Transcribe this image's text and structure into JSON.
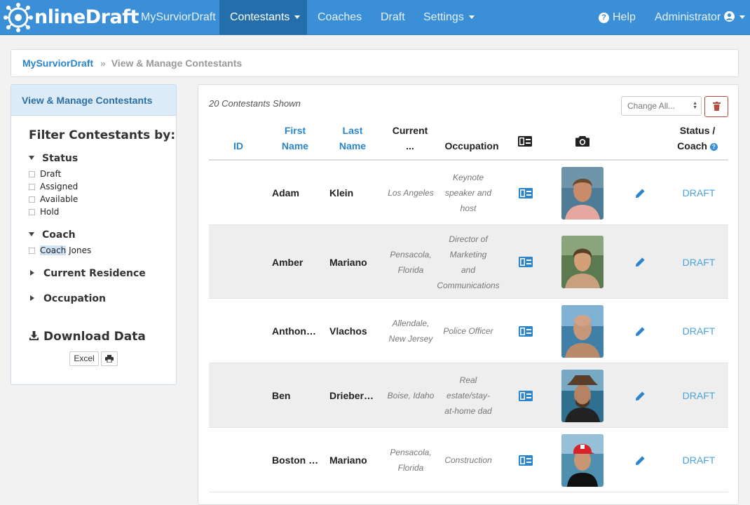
{
  "colors": {
    "navbar": "#3a8fd6",
    "nav_active": "#236eab",
    "link": "#2a85cc",
    "draft": "#4aa3df"
  },
  "brand": {
    "name": "nlineDraft",
    "logo": "network-logo-icon"
  },
  "nav": {
    "items": [
      {
        "label": "MySurviorDraft"
      },
      {
        "label": "Contestants"
      },
      {
        "label": "Coaches"
      },
      {
        "label": "Draft"
      },
      {
        "label": "Settings"
      }
    ],
    "help": "Help",
    "user": "Administrator"
  },
  "breadcrumb": {
    "root": "MySurviorDraft",
    "sep": "»",
    "current": "View & Manage Contestants"
  },
  "sidebar": {
    "header": "View & Manage Contestants",
    "filter_title": "Filter Contestants by:",
    "status": {
      "title": "Status",
      "options": [
        "Draft",
        "Assigned",
        "Available",
        "Hold"
      ]
    },
    "coach": {
      "title": "Coach",
      "option_highlight": "Coach",
      "option_rest": " Jones"
    },
    "residence": {
      "title": "Current Residence"
    },
    "occupation": {
      "title": "Occupation"
    },
    "download": {
      "title": "Download Data",
      "excel": "Excel",
      "print_icon": "printer-icon"
    }
  },
  "main": {
    "count": "20 Contestants Shown",
    "change_all": "Change All...",
    "headers": {
      "id": "ID",
      "first1": "First",
      "first2": "Name",
      "last1": "Last",
      "last2": "Name",
      "current1": "Current",
      "current2": "...",
      "occupation": "Occupation",
      "status1": "Status /",
      "status2": "Coach"
    },
    "rows": [
      {
        "first": "Adam",
        "last": "Klein",
        "residence": [
          "Los Angeles"
        ],
        "occupation": [
          "Keynote",
          "speaker and",
          "host"
        ],
        "status": "DRAFT"
      },
      {
        "first": "Amber",
        "last": "Mariano",
        "residence": [
          "Pensacola,",
          "Florida"
        ],
        "occupation": [
          "Director of",
          "Marketing",
          "and",
          "Communications"
        ],
        "status": "DRAFT"
      },
      {
        "first": "Anthon…",
        "last": "Vlachos",
        "residence": [
          "Allendale,",
          "New Jersey"
        ],
        "occupation": [
          "Police Officer"
        ],
        "status": "DRAFT"
      },
      {
        "first": "Ben",
        "last": "Drieber…",
        "residence": [
          "Boise, Idaho"
        ],
        "occupation": [
          "Real",
          "estate/stay-",
          "at-home dad"
        ],
        "status": "DRAFT"
      },
      {
        "first": "Boston …",
        "last": "Mariano",
        "residence": [
          "Pensacola,",
          "Florida"
        ],
        "occupation": [
          "Construction"
        ],
        "status": "DRAFT"
      }
    ]
  }
}
